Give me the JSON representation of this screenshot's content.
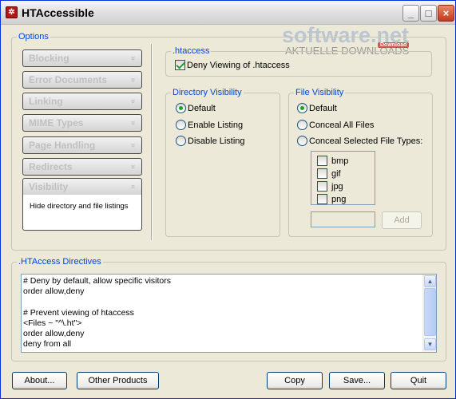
{
  "window": {
    "title": "HTAccessible",
    "controls": {
      "minimize": "_",
      "maximize": "□",
      "close": "×"
    }
  },
  "watermark": {
    "main": "software.net",
    "sub": "AKTUELLE DOWNLOADS",
    "badge": "Download"
  },
  "options": {
    "title": "Options",
    "items": [
      {
        "label": "Blocking",
        "expanded": false
      },
      {
        "label": "Error Documents",
        "expanded": false
      },
      {
        "label": "Linking",
        "expanded": false
      },
      {
        "label": "MIME Types",
        "expanded": false
      },
      {
        "label": "Page Handling",
        "expanded": false
      },
      {
        "label": "Redirects",
        "expanded": false
      },
      {
        "label": "Visibility",
        "expanded": true
      }
    ],
    "expanded_description": "Hide directory and file listings",
    "chevron_down": "»",
    "chevron_up": "«"
  },
  "htaccess_group": {
    "title": ".htaccess",
    "deny_viewing": {
      "label": "Deny Viewing of .htaccess",
      "checked": true
    }
  },
  "directory_visibility": {
    "title": "Directory Visibility",
    "options": [
      {
        "label": "Default",
        "selected": true
      },
      {
        "label": "Enable Listing",
        "selected": false
      },
      {
        "label": "Disable Listing",
        "selected": false
      }
    ]
  },
  "file_visibility": {
    "title": "File Visibility",
    "options": [
      {
        "label": "Default",
        "selected": true
      },
      {
        "label": "Conceal All Files",
        "selected": false
      },
      {
        "label": "Conceal Selected File Types:",
        "selected": false
      }
    ],
    "file_types": [
      {
        "label": "bmp",
        "checked": false
      },
      {
        "label": "gif",
        "checked": false
      },
      {
        "label": "jpg",
        "checked": false
      },
      {
        "label": "png",
        "checked": false
      }
    ],
    "new_type_value": "",
    "add_label": "Add"
  },
  "directives": {
    "title": ".HTAccess Directives",
    "lines": [
      "# Deny by default, allow specific visitors",
      "order allow,deny",
      "",
      "# Prevent viewing of htaccess",
      "<Files ~ \"^\\.ht\">",
      "order allow,deny",
      "deny from all"
    ],
    "scroll_up": "▲",
    "scroll_down": "▼"
  },
  "buttons": {
    "about": "About...",
    "other_products": "Other Products",
    "copy": "Copy",
    "save": "Save...",
    "quit": "Quit"
  },
  "colors": {
    "group_title": "#0046d5",
    "window_bg": "#ece9d8",
    "check_mark": "#21a121"
  }
}
